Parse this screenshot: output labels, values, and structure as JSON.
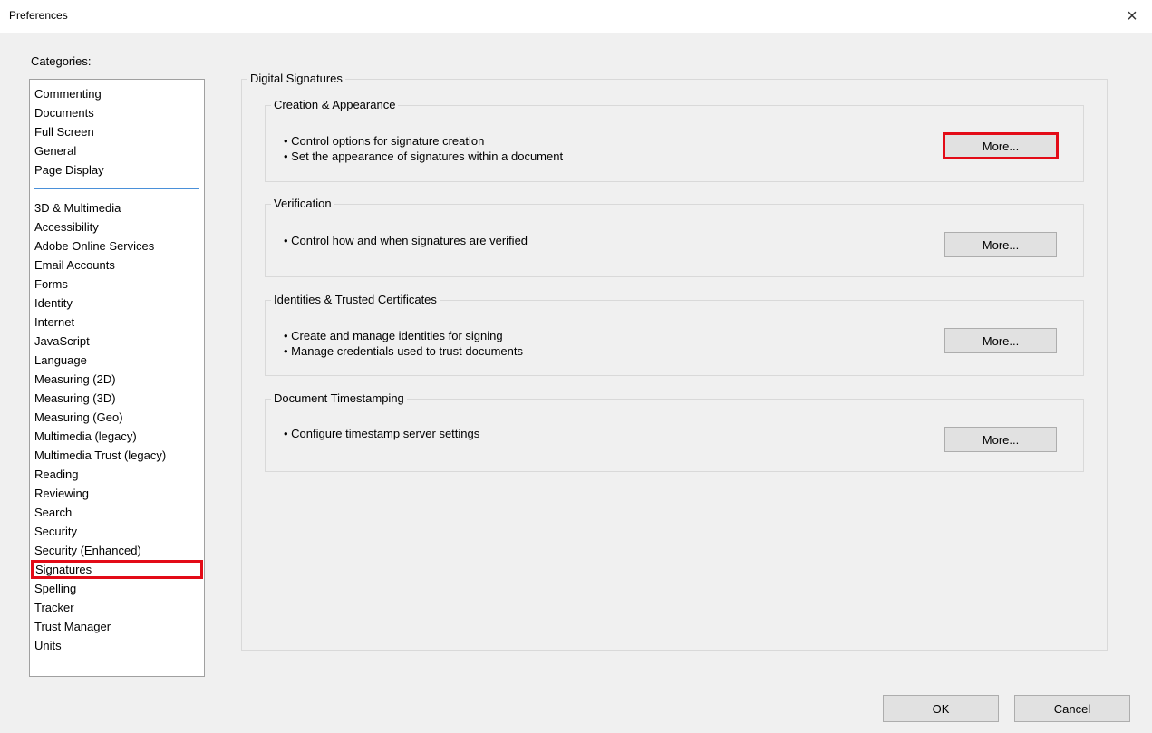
{
  "window": {
    "title": "Preferences",
    "close_symbol": "×"
  },
  "categories": {
    "label": "Categories:",
    "group1": [
      "Commenting",
      "Documents",
      "Full Screen",
      "General",
      "Page Display"
    ],
    "group2": [
      "3D & Multimedia",
      "Accessibility",
      "Adobe Online Services",
      "Email Accounts",
      "Forms",
      "Identity",
      "Internet",
      "JavaScript",
      "Language",
      "Measuring (2D)",
      "Measuring (3D)",
      "Measuring (Geo)",
      "Multimedia (legacy)",
      "Multimedia Trust (legacy)",
      "Reading",
      "Reviewing",
      "Search",
      "Security",
      "Security (Enhanced)",
      "Signatures",
      "Spelling",
      "Tracker",
      "Trust Manager",
      "Units"
    ],
    "selected": "Signatures"
  },
  "panel": {
    "title": "Digital Signatures",
    "sections": [
      {
        "title": "Creation & Appearance",
        "bullets": [
          "• Control options for signature creation",
          "• Set the appearance of signatures within a document"
        ],
        "button": "More..."
      },
      {
        "title": "Verification",
        "bullets": [
          "• Control how and when signatures are verified"
        ],
        "button": "More..."
      },
      {
        "title": "Identities & Trusted Certificates",
        "bullets": [
          "• Create and manage identities for signing",
          "• Manage credentials used to trust documents"
        ],
        "button": "More..."
      },
      {
        "title": "Document Timestamping",
        "bullets": [
          "• Configure timestamp server settings"
        ],
        "button": "More..."
      }
    ]
  },
  "footer": {
    "ok_label": "OK",
    "cancel_label": "Cancel"
  },
  "colors": {
    "highlight": "#e30b17",
    "separator": "#4a90d9"
  }
}
